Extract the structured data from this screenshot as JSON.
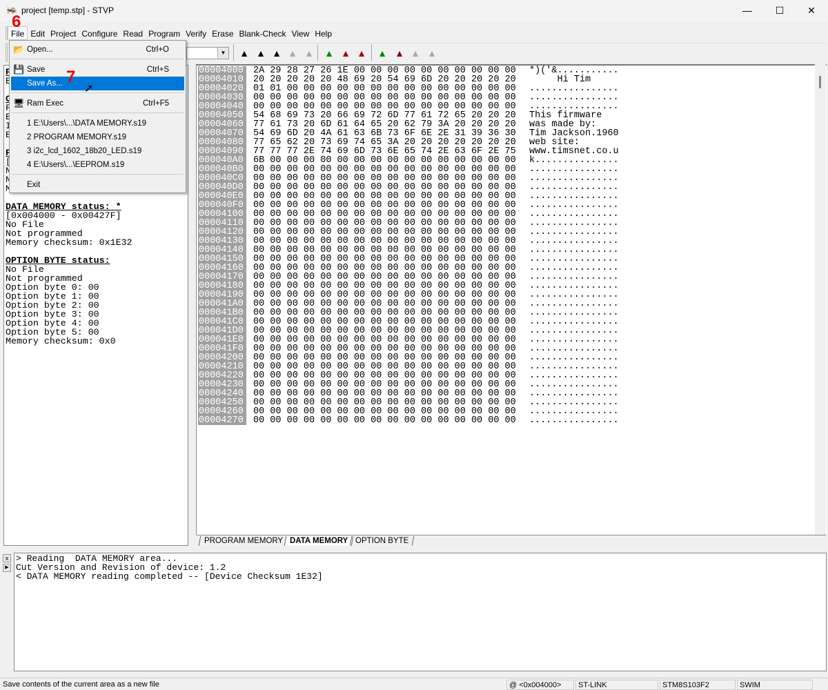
{
  "window": {
    "title": "project [temp.stp] - STVP",
    "minimize": "—",
    "maximize": "☐",
    "close": "✕"
  },
  "menubar": [
    "File",
    "Edit",
    "Project",
    "Configure",
    "Read",
    "Program",
    "Verify",
    "Erase",
    "Blank-Check",
    "View",
    "Help"
  ],
  "annotations": {
    "step1": "6",
    "step2": "7"
  },
  "toolbar": {
    "icons": [
      "program-icon",
      "read-icon",
      "verify-icon",
      "erase-icon",
      "blank-check-icon",
      "program-all-icon",
      "read-all-icon",
      "verify-all-icon",
      "program-green-icon",
      "read-red-icon",
      "verify-dual-icon",
      "erase-gray-icon"
    ]
  },
  "file_menu": {
    "items": [
      {
        "label": "Open...",
        "shortcut": "Ctrl+O",
        "icon": "open-folder-icon"
      },
      {
        "label": "Save",
        "shortcut": "Ctrl+S",
        "icon": "save-disk-icon"
      },
      {
        "label": "Save As...",
        "shortcut": "",
        "icon": ""
      },
      {
        "label": "Ram Exec",
        "shortcut": "Ctrl+F5",
        "icon": "ram-exec-icon"
      },
      {
        "label": "1 E:\\Users\\...\\DATA MEMORY.s19"
      },
      {
        "label": "2 PROGRAM MEMORY.s19"
      },
      {
        "label": "3 i2c_lcd_1602_18b20_LED.s19"
      },
      {
        "label": "4 E:\\Users\\...\\EEPROM.s19"
      },
      {
        "label": "Exit"
      }
    ]
  },
  "left_panel": {
    "lines": [
      "P",
      "B",
      "",
      "C",
      "F",
      "E",
      "I",
      "E",
      "",
      "P",
      "[",
      "N",
      "N",
      "Memory checksum: 0x0",
      "",
      "DATA MEMORY status: *",
      "[0x004000 - 0x00427F]",
      "No File",
      "Not programmed",
      "Memory checksum: 0x1E32",
      "",
      "OPTION BYTE status:",
      "No File",
      "Not programmed",
      "Option byte 0: 00",
      "Option byte 1: 00",
      "Option byte 2: 00",
      "Option byte 3: 00",
      "Option byte 4: 00",
      "Option byte 5: 00",
      "Memory checksum: 0x0"
    ]
  },
  "hex": {
    "rows": [
      [
        "00004000",
        "2A 29 28 27 26 1E 00 00 00 00 00 00 00 00 00 00",
        "*)('&..........."
      ],
      [
        "00004010",
        "20 20 20 20 20 48 69 20 54 69 6D 20 20 20 20 20",
        "     Hi Tim     "
      ],
      [
        "00004020",
        "01 01 00 00 00 00 00 00 00 00 00 00 00 00 00 00",
        "................"
      ],
      [
        "00004030",
        "00 00 00 00 00 00 00 00 00 00 00 00 00 00 00 00",
        "................"
      ],
      [
        "00004040",
        "00 00 00 00 00 00 00 00 00 00 00 00 00 00 00 00",
        "................"
      ],
      [
        "00004050",
        "54 68 69 73 20 66 69 72 6D 77 61 72 65 20 20 20",
        "This firmware   "
      ],
      [
        "00004060",
        "77 61 73 20 6D 61 64 65 20 62 79 3A 20 20 20 20",
        "was made by:    "
      ],
      [
        "00004070",
        "54 69 6D 20 4A 61 63 6B 73 6F 6E 2E 31 39 36 30",
        "Tim Jackson.1960"
      ],
      [
        "00004080",
        "77 65 62 20 73 69 74 65 3A 20 20 20 20 20 20 20",
        "web site:       "
      ],
      [
        "00004090",
        "77 77 77 2E 74 69 6D 73 6E 65 74 2E 63 6F 2E 75",
        "www.timsnet.co.u"
      ],
      [
        "000040A0",
        "6B 00 00 00 00 00 00 00 00 00 00 00 00 00 00 00",
        "k..............."
      ],
      [
        "000040B0",
        "00 00 00 00 00 00 00 00 00 00 00 00 00 00 00 00",
        "................"
      ],
      [
        "000040C0",
        "00 00 00 00 00 00 00 00 00 00 00 00 00 00 00 00",
        "................"
      ],
      [
        "000040D0",
        "00 00 00 00 00 00 00 00 00 00 00 00 00 00 00 00",
        "................"
      ],
      [
        "000040E0",
        "00 00 00 00 00 00 00 00 00 00 00 00 00 00 00 00",
        "................"
      ],
      [
        "000040F0",
        "00 00 00 00 00 00 00 00 00 00 00 00 00 00 00 00",
        "................"
      ],
      [
        "00004100",
        "00 00 00 00 00 00 00 00 00 00 00 00 00 00 00 00",
        "................"
      ],
      [
        "00004110",
        "00 00 00 00 00 00 00 00 00 00 00 00 00 00 00 00",
        "................"
      ],
      [
        "00004120",
        "00 00 00 00 00 00 00 00 00 00 00 00 00 00 00 00",
        "................"
      ],
      [
        "00004130",
        "00 00 00 00 00 00 00 00 00 00 00 00 00 00 00 00",
        "................"
      ],
      [
        "00004140",
        "00 00 00 00 00 00 00 00 00 00 00 00 00 00 00 00",
        "................"
      ],
      [
        "00004150",
        "00 00 00 00 00 00 00 00 00 00 00 00 00 00 00 00",
        "................"
      ],
      [
        "00004160",
        "00 00 00 00 00 00 00 00 00 00 00 00 00 00 00 00",
        "................"
      ],
      [
        "00004170",
        "00 00 00 00 00 00 00 00 00 00 00 00 00 00 00 00",
        "................"
      ],
      [
        "00004180",
        "00 00 00 00 00 00 00 00 00 00 00 00 00 00 00 00",
        "................"
      ],
      [
        "00004190",
        "00 00 00 00 00 00 00 00 00 00 00 00 00 00 00 00",
        "................"
      ],
      [
        "000041A0",
        "00 00 00 00 00 00 00 00 00 00 00 00 00 00 00 00",
        "................"
      ],
      [
        "000041B0",
        "00 00 00 00 00 00 00 00 00 00 00 00 00 00 00 00",
        "................"
      ],
      [
        "000041C0",
        "00 00 00 00 00 00 00 00 00 00 00 00 00 00 00 00",
        "................"
      ],
      [
        "000041D0",
        "00 00 00 00 00 00 00 00 00 00 00 00 00 00 00 00",
        "................"
      ],
      [
        "000041E0",
        "00 00 00 00 00 00 00 00 00 00 00 00 00 00 00 00",
        "................"
      ],
      [
        "000041F0",
        "00 00 00 00 00 00 00 00 00 00 00 00 00 00 00 00",
        "................"
      ],
      [
        "00004200",
        "00 00 00 00 00 00 00 00 00 00 00 00 00 00 00 00",
        "................"
      ],
      [
        "00004210",
        "00 00 00 00 00 00 00 00 00 00 00 00 00 00 00 00",
        "................"
      ],
      [
        "00004220",
        "00 00 00 00 00 00 00 00 00 00 00 00 00 00 00 00",
        "................"
      ],
      [
        "00004230",
        "00 00 00 00 00 00 00 00 00 00 00 00 00 00 00 00",
        "................"
      ],
      [
        "00004240",
        "00 00 00 00 00 00 00 00 00 00 00 00 00 00 00 00",
        "................"
      ],
      [
        "00004250",
        "00 00 00 00 00 00 00 00 00 00 00 00 00 00 00 00",
        "................"
      ],
      [
        "00004260",
        "00 00 00 00 00 00 00 00 00 00 00 00 00 00 00 00",
        "................"
      ],
      [
        "00004270",
        "00 00 00 00 00 00 00 00 00 00 00 00 00 00 00 00",
        "................"
      ]
    ]
  },
  "tabs": [
    {
      "label": "PROGRAM MEMORY",
      "active": false
    },
    {
      "label": "DATA MEMORY",
      "active": true
    },
    {
      "label": "OPTION BYTE",
      "active": false
    }
  ],
  "log": {
    "lines": [
      "> Reading  DATA MEMORY area...",
      "Cut Version and Revision of device: 1.2",
      "< DATA MEMORY reading completed -- [Device Checksum 1E32]"
    ]
  },
  "statusbar": {
    "message": "Save contents of the current area as a new file",
    "address": "@ <0x004000>",
    "programmer": "ST-LINK",
    "device": "STM8S103F2",
    "protocol": "SWIM"
  },
  "colors": {
    "highlight": "#0078d7",
    "address_bg": "#a0a0a0",
    "annotation": "#ee0000"
  }
}
